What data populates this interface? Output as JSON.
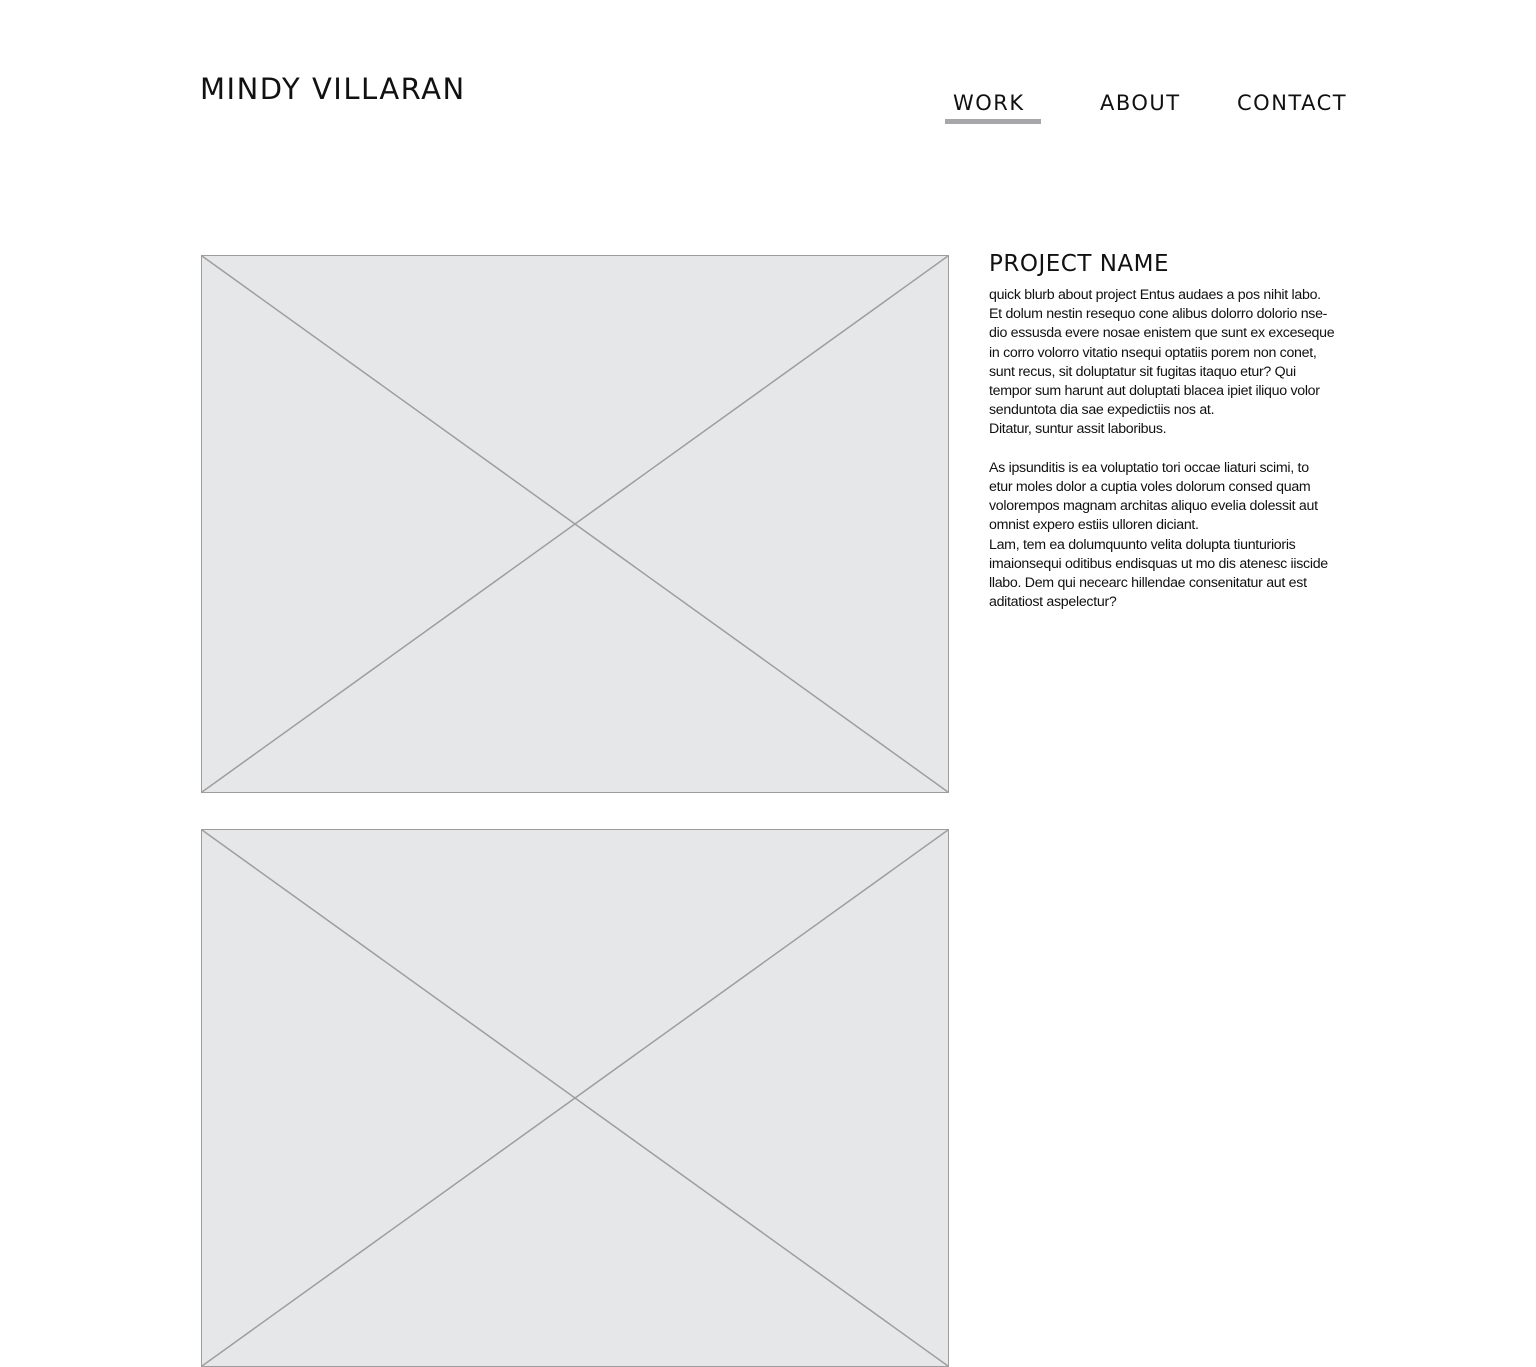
{
  "header": {
    "brand": "MINDY VILLARAN",
    "nav": [
      {
        "label": "WORK",
        "active": true
      },
      {
        "label": "ABOUT",
        "active": false
      },
      {
        "label": "CONTACT",
        "active": false
      }
    ]
  },
  "project": {
    "title": "PROJECT NAME",
    "paragraph_1": [
      "quick blurb about project Entus audaes a pos nihit labo.",
      "Et dolum nestin resequo cone alibus dolorro dolorio nse-",
      "dio essusda evere nosae enistem que sunt ex exceseque",
      "in corro volorro vitatio nsequi optatiis porem non conet,",
      "sunt recus, sit doluptatur sit fugitas itaquo etur? Qui",
      "tempor sum harunt aut doluptati blacea ipiet iliquo volor",
      "senduntota dia sae expedictiis nos at.",
      "Ditatur, suntur assit laboribus."
    ],
    "paragraph_2": [
      "As ipsunditis is ea voluptatio tori occae liaturi scimi, to",
      "etur moles dolor a cuptia voles dolorum consed quam",
      "volorempos magnam architas aliquo evelia dolessit aut",
      "omnist expero estiis ulloren diciant.",
      "Lam, tem ea dolumquunto velita dolupta tiunturioris",
      "imaionsequi oditibus endisquas ut mo dis atenesc iiscide",
      "llabo. Dem qui necearc hillendae consenitatur aut est",
      "aditatiost aspelectur?"
    ]
  },
  "colors": {
    "placeholder_fill": "#e6e7e8",
    "placeholder_stroke": "#9d9d9d",
    "nav_active_underline": "#a7a7a9"
  }
}
